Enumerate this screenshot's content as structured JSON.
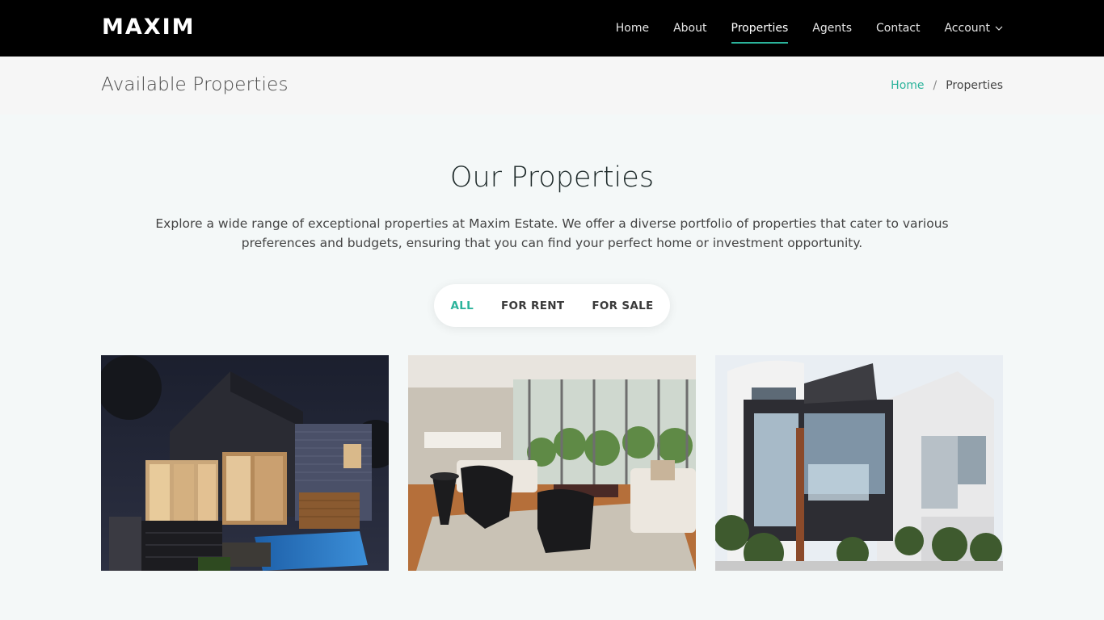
{
  "brand": {
    "logo": "MAXIM"
  },
  "nav": {
    "items": [
      {
        "label": "Home",
        "active": false
      },
      {
        "label": "About",
        "active": false
      },
      {
        "label": "Properties",
        "active": true
      },
      {
        "label": "Agents",
        "active": false
      },
      {
        "label": "Contact",
        "active": false
      }
    ],
    "account_label": "Account",
    "account_icon": "chevron-down-icon"
  },
  "titlebar": {
    "title": "Available Properties",
    "breadcrumb": {
      "home": "Home",
      "separator": "/",
      "current": "Properties"
    }
  },
  "section": {
    "title": "Our Properties",
    "description": "Explore a wide range of exceptional properties at Maxim Estate. We offer a diverse portfolio of properties that cater to various preferences and budgets, ensuring that you can find your perfect home or investment opportunity."
  },
  "filters": [
    {
      "label": "ALL",
      "active": true
    },
    {
      "label": "FOR RENT",
      "active": false
    },
    {
      "label": "FOR SALE",
      "active": false
    }
  ],
  "colors": {
    "accent": "#2bb39b",
    "header_bg": "#000000",
    "titlebar_bg": "#f6f6f6",
    "page_bg": "#f4f8f8"
  }
}
